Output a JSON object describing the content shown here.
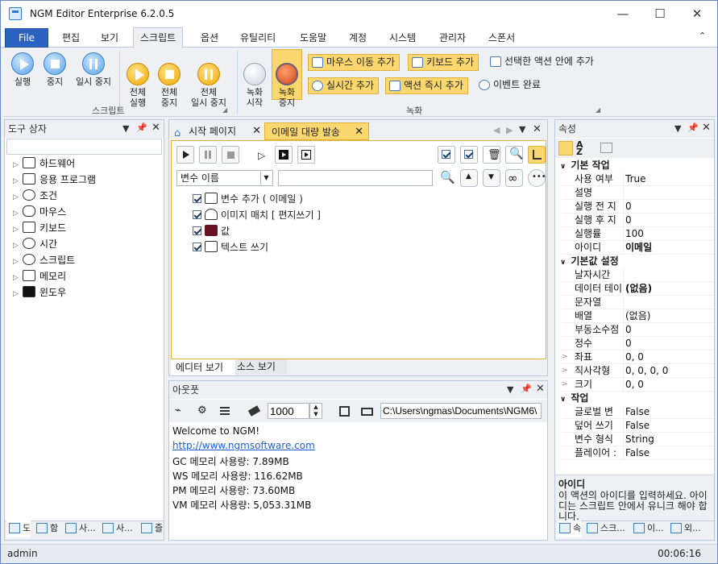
{
  "app": {
    "title": "NGM Editor   Enterprise 6.2.0.5"
  },
  "window_controls": {
    "minimize": "—",
    "maximize": "☐",
    "close": "✕"
  },
  "menu": [
    "File",
    "편집",
    "보기",
    "스크립트",
    "옵션",
    "유틸리티",
    "도움말",
    "계정",
    "시스템",
    "관리자",
    "스폰서"
  ],
  "menu_active": "스크립트",
  "ribbon": {
    "script_group": {
      "label": "스크립트",
      "buttons": [
        "실행",
        "중지",
        "일시 중지",
        "전체\n실행",
        "전체\n중지",
        "전체\n일시 중지"
      ]
    },
    "record_group": {
      "label": "녹화",
      "buttons": [
        "녹화\n시작",
        "녹화\n중지"
      ],
      "small_buttons": [
        "마우스 이동 추가",
        "키보드 추가",
        "선택한 액션 안에 추가",
        "실시간 추가",
        "액션 즉시 추가",
        "이벤트 완료"
      ]
    }
  },
  "toolbox": {
    "title": "도구 상자",
    "search": "",
    "items": [
      "하드웨어",
      "응용 프로그램",
      "조건",
      "마우스",
      "키보드",
      "시간",
      "스크립트",
      "메모리",
      "윈도우"
    ],
    "bottom_tabs": [
      "도",
      "함",
      "사...",
      "사...",
      "즐"
    ]
  },
  "editor": {
    "tabs": [
      "시작 페이지",
      "이메일 대량 발송"
    ],
    "active_tab": "이메일 대량 발송",
    "variable_select": "변수 이름",
    "search_value": "",
    "actions": [
      "변수 추가 ( 이메일 )",
      "이미지 매치 [ 편지쓰기 ]",
      "값",
      "텍스트 쓰기"
    ],
    "view_tabs": [
      "에디터 보기",
      "소스 보기"
    ]
  },
  "output": {
    "title": "아웃풋",
    "number": "1000",
    "path": "C:\\Users\\ngmas\\Documents\\NGM6\\",
    "lines": [
      "Welcome to NGM!",
      "http://www.ngmsoftware.com",
      "GC 메모리 사용량: 7.89MB",
      "WS 메모리 사용량: 116.62MB",
      "PM 메모리 사용량: 73.60MB",
      "VM 메모리 사용량: 5,053.31MB"
    ]
  },
  "properties": {
    "title": "속성",
    "categories": [
      {
        "name": "기본 작업",
        "rows": [
          [
            "사용 여부",
            "True"
          ],
          [
            "설명",
            ""
          ],
          [
            "실행 전 지",
            "0"
          ],
          [
            "실행 후 지",
            "0"
          ],
          [
            "실행률",
            "100"
          ],
          [
            "아이디",
            "이메일"
          ]
        ]
      },
      {
        "name": "기본값 설정",
        "rows": [
          [
            "날자시간",
            ""
          ],
          [
            "데이터 테이",
            "(없음)"
          ],
          [
            "문자열",
            ""
          ],
          [
            "배열",
            "(없음)"
          ],
          [
            "부동소수점",
            "0"
          ],
          [
            "정수",
            "0"
          ],
          [
            "좌표",
            "0, 0"
          ],
          [
            "직사각형",
            "0, 0, 0, 0"
          ],
          [
            "크기",
            "0, 0"
          ]
        ]
      },
      {
        "name": "작업",
        "rows": [
          [
            "글로벌 변",
            "False"
          ],
          [
            "덮어 쓰기",
            "False"
          ],
          [
            "변수 형식",
            "String"
          ],
          [
            "플레이어 :",
            "False"
          ]
        ]
      }
    ],
    "desc_title": "아이디",
    "desc_text": "이 액션의 아이디를 입력하세요. 아이디는 스크립트 안에서 유니크 해야 합니다.",
    "bottom_tabs": [
      "속",
      "스크...",
      "이...",
      "외..."
    ]
  },
  "status": {
    "user": "admin",
    "time": "00:06:16"
  }
}
